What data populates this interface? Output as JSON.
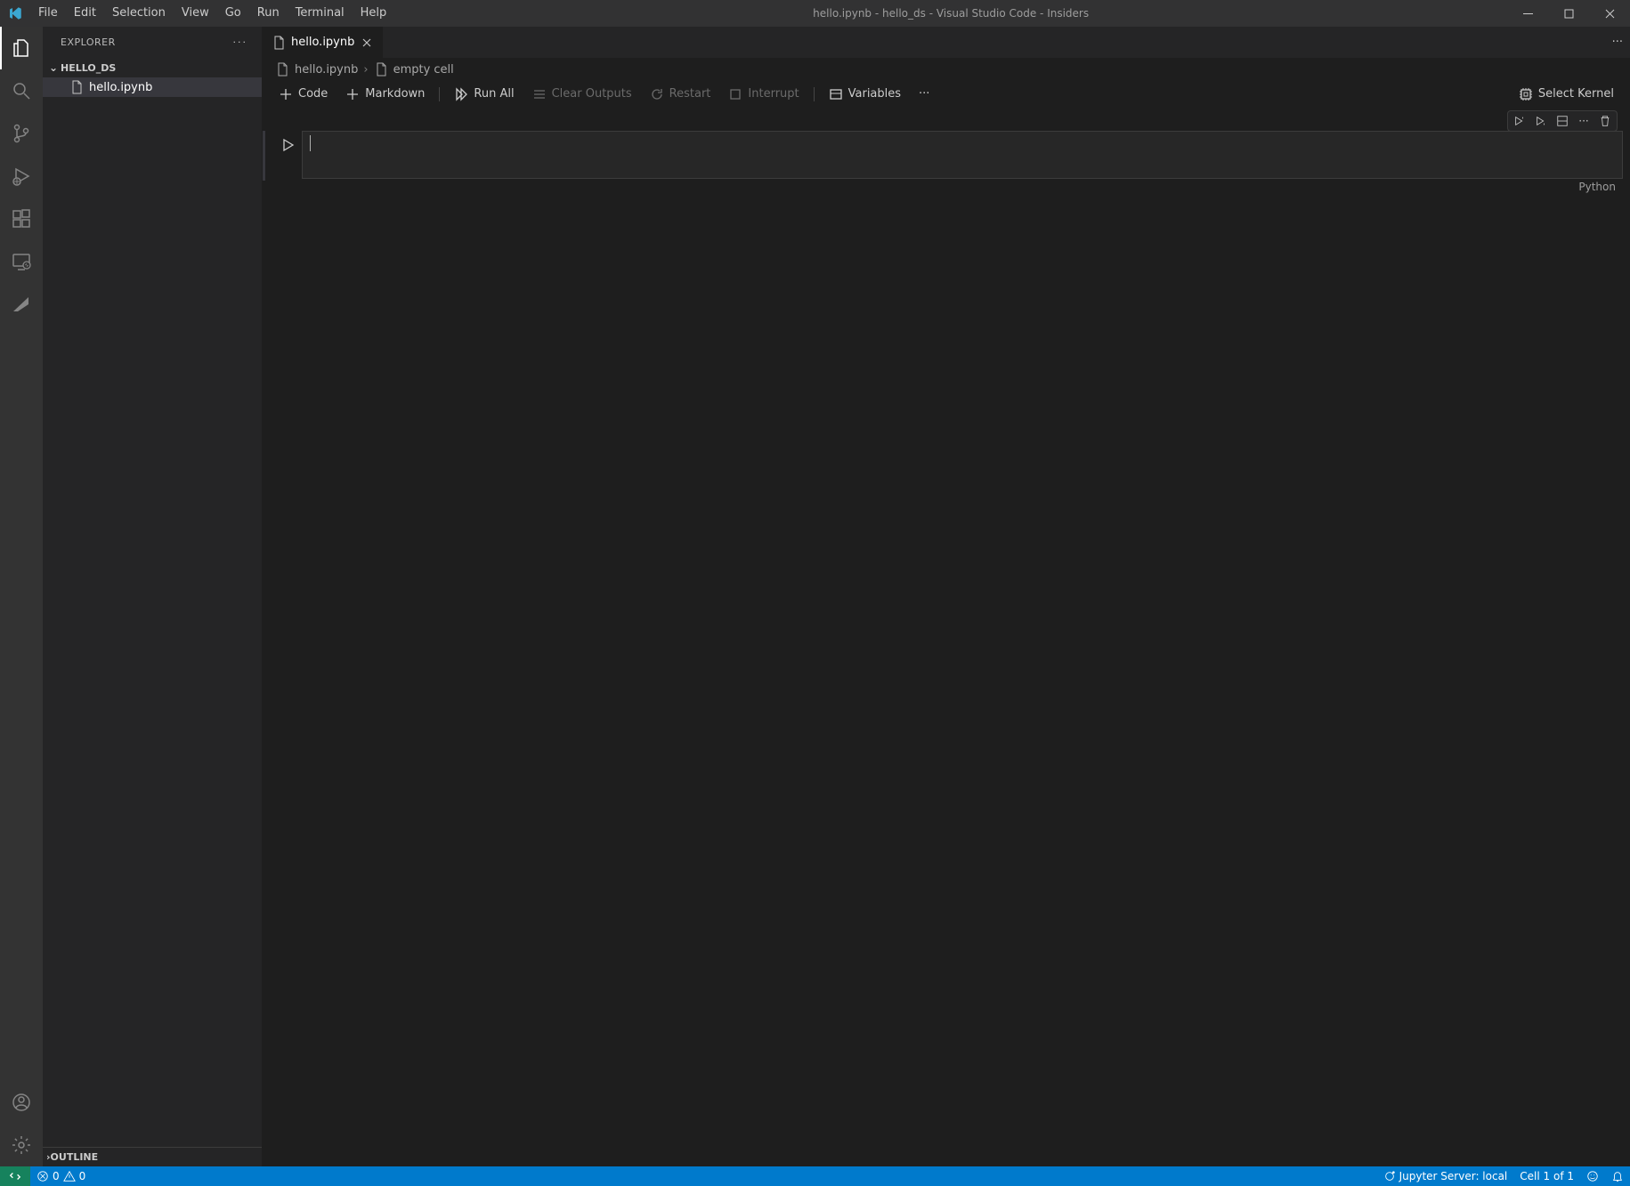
{
  "titlebar": {
    "menu": [
      "File",
      "Edit",
      "Selection",
      "View",
      "Go",
      "Run",
      "Terminal",
      "Help"
    ],
    "title": "hello.ipynb - hello_ds - Visual Studio Code - Insiders"
  },
  "activitybar": {
    "top": [
      "explorer",
      "search",
      "source-control",
      "run-debug",
      "extensions",
      "remote-explorer",
      "copilot"
    ],
    "bottom": [
      "accounts",
      "settings"
    ]
  },
  "sidebar": {
    "panel_title": "EXPLORER",
    "folder_name": "HELLO_DS",
    "files": [
      {
        "name": "hello.ipynb"
      }
    ],
    "outline_label": "OUTLINE"
  },
  "tabs": [
    {
      "name": "hello.ipynb"
    }
  ],
  "breadcrumb": {
    "file": "hello.ipynb",
    "segment": "empty cell"
  },
  "notebook_toolbar": {
    "code": "Code",
    "markdown": "Markdown",
    "run_all": "Run All",
    "clear_outputs": "Clear Outputs",
    "restart": "Restart",
    "interrupt": "Interrupt",
    "variables": "Variables",
    "select_kernel": "Select Kernel"
  },
  "cell": {
    "language": "Python"
  },
  "statusbar": {
    "errors": "0",
    "warnings": "0",
    "jupyter": "Jupyter Server: local",
    "cell_status": "Cell 1 of 1"
  }
}
